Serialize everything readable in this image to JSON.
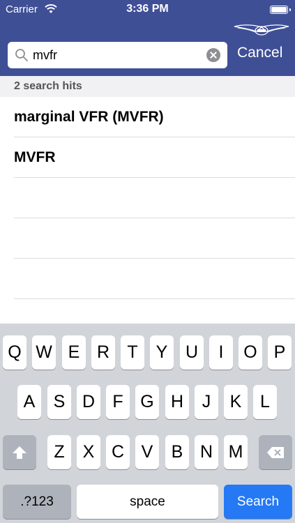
{
  "status_bar": {
    "carrier": "Carrier",
    "time": "3:36 PM"
  },
  "search": {
    "query": "mvfr",
    "cancel_label": "Cancel"
  },
  "results": {
    "count_label": "2 search hits",
    "items": [
      "marginal VFR (MVFR)",
      "MVFR"
    ]
  },
  "keyboard": {
    "row1": [
      "Q",
      "W",
      "E",
      "R",
      "T",
      "Y",
      "U",
      "I",
      "O",
      "P"
    ],
    "row2": [
      "A",
      "S",
      "D",
      "F",
      "G",
      "H",
      "J",
      "K",
      "L"
    ],
    "row3": [
      "Z",
      "X",
      "C",
      "V",
      "B",
      "N",
      "M"
    ],
    "numbers_label": ".?123",
    "space_label": "space",
    "search_label": "Search"
  },
  "colors": {
    "header_bg": "#3f4f96",
    "search_key": "#2579f5"
  }
}
